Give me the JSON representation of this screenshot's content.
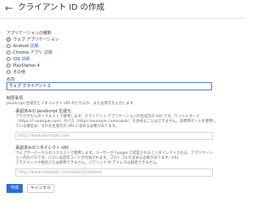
{
  "header": {
    "back_icon": "arrow-left-icon",
    "back_glyph": "←",
    "title": "クライアント ID の作成"
  },
  "app_type": {
    "label": "アプリケーションの種類",
    "options": [
      {
        "label": "ウェブ アプリケーション",
        "selected": true
      },
      {
        "label": "Android",
        "link": "詳細"
      },
      {
        "label": "Chrome アプリ",
        "link": "詳細"
      },
      {
        "label": "iOS",
        "link": "詳細"
      },
      {
        "label": "PlayStation 4"
      },
      {
        "label": "その他"
      }
    ]
  },
  "name": {
    "label": "名前",
    "value": "ウェブ クライアント 1"
  },
  "restrictions": {
    "title": "制限事項",
    "description": "JavaScript 生成元とリダイレクト URI のどちらか、または両方を入力します",
    "js_origins": {
      "title": "承認済みの JavaScript 生成元",
      "desc": [
        "ブラウザからのリクエストで使用します。クライアント アプリケーションの生成元の URI です。ワイルドカード",
        "（https://*.example.com）やパス（https://example.com/subdir）を含めることはできません。非標準ポートを使用し",
        "ている場合は、それを生成元の URI に含める必要があります。"
      ],
      "placeholder": "http://www.example.com"
    },
    "redirect_uris": {
      "title": "承認済みのリダイレクト URI",
      "desc": [
        "ウェブサーバーからのリクエストで使用します。ユーザーが Google で認証されるとリダイレクトされる、アプリケーシ",
        "ョン内のパスです。パスには認可コードが付加されます。プロトコルを含める必要があります。URL",
        "フラグメントや相対パスは使用できません。パブリック IP アドレスは指定できません。"
      ],
      "placeholder": "http://www.example.com/oauth2callback"
    }
  },
  "buttons": {
    "create": "作成",
    "cancel": "キャンセル"
  }
}
